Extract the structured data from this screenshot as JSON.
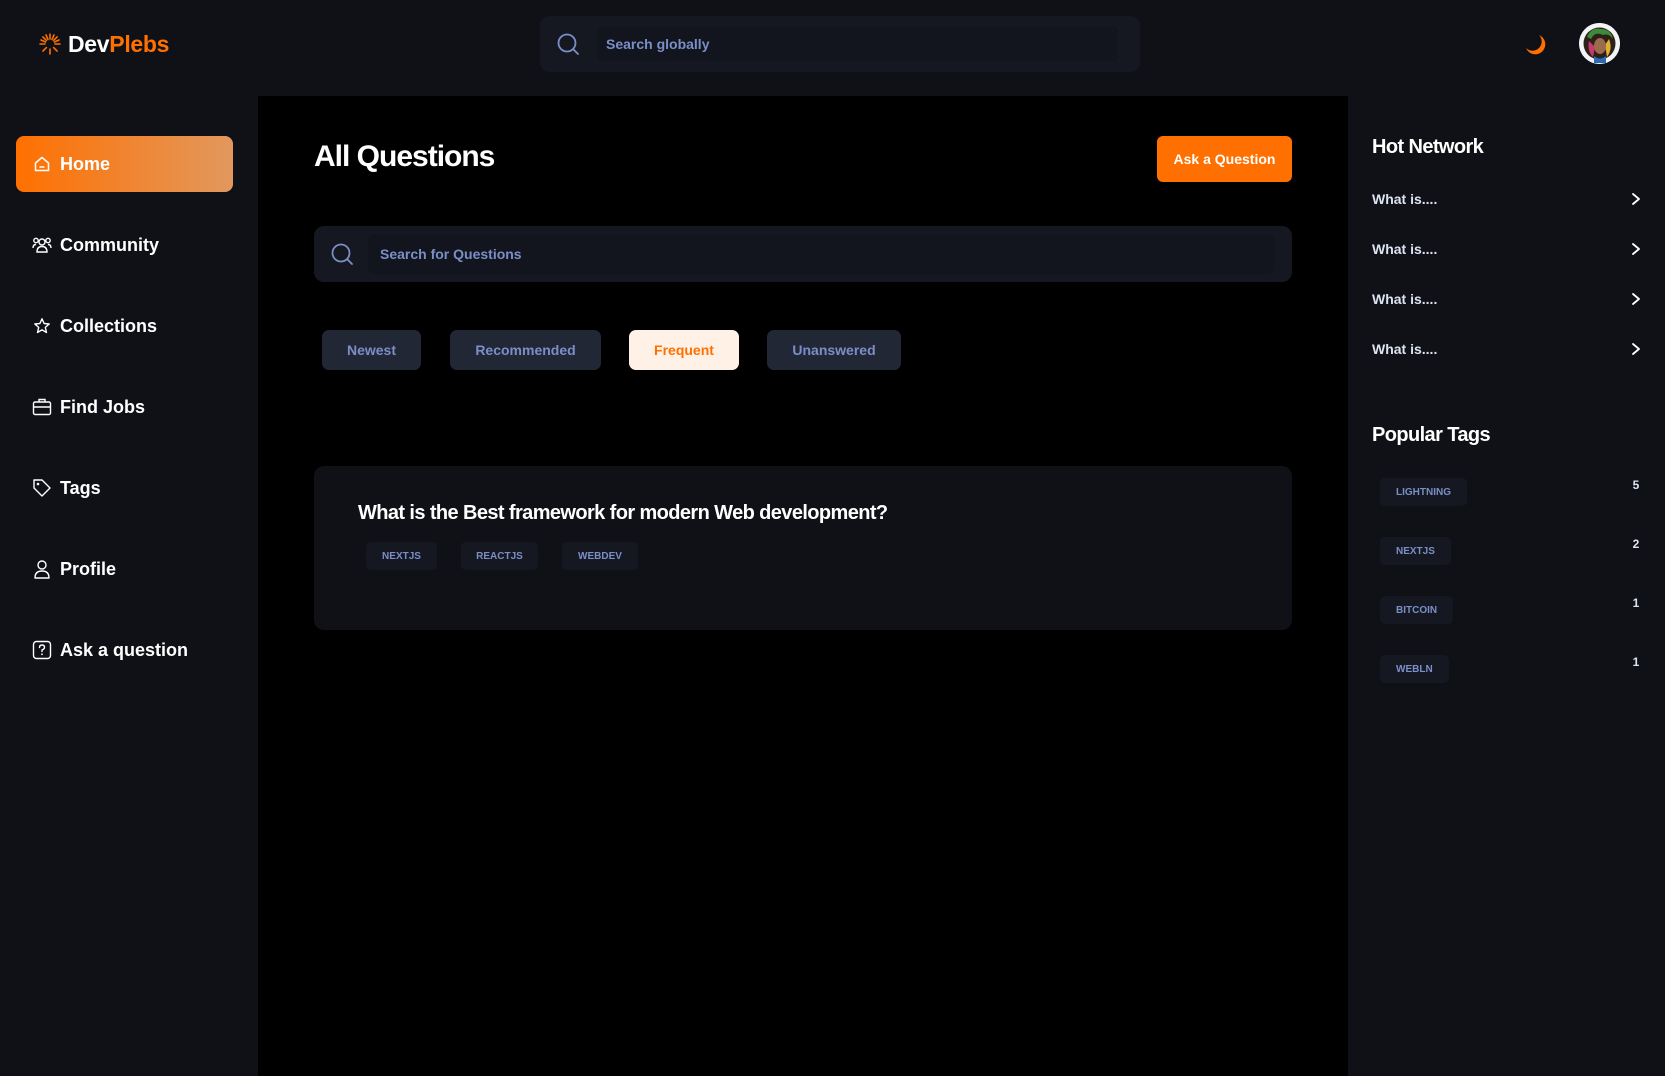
{
  "brand": {
    "part1": "Dev",
    "part2": "Plebs"
  },
  "header": {
    "search_placeholder": "Search globally"
  },
  "sidebar": {
    "items": [
      {
        "label": "Home",
        "icon": "home-icon",
        "active": true
      },
      {
        "label": "Community",
        "icon": "users-icon",
        "active": false
      },
      {
        "label": "Collections",
        "icon": "star-icon",
        "active": false
      },
      {
        "label": "Find Jobs",
        "icon": "suitcase-icon",
        "active": false
      },
      {
        "label": "Tags",
        "icon": "tag-icon",
        "active": false
      },
      {
        "label": "Profile",
        "icon": "user-icon",
        "active": false
      },
      {
        "label": "Ask a question",
        "icon": "question-icon",
        "active": false
      }
    ]
  },
  "main": {
    "title": "All Questions",
    "ask_button": "Ask a Question",
    "search_placeholder": "Search for Questions",
    "filters": [
      {
        "label": "Newest",
        "active": false
      },
      {
        "label": "Recommended",
        "active": false
      },
      {
        "label": "Frequent",
        "active": true
      },
      {
        "label": "Unanswered",
        "active": false
      }
    ],
    "questions": [
      {
        "title": "What is the Best framework for modern Web development?",
        "tags": [
          "NEXTJS",
          "REACTJS",
          "WEBDEV"
        ]
      }
    ]
  },
  "right": {
    "hot_network_title": "Hot Network",
    "hot_network": [
      "What is....",
      "What is....",
      "What is....",
      "What is...."
    ],
    "popular_tags_title": "Popular Tags",
    "popular_tags": [
      {
        "name": "LIGHTNING",
        "count": "5"
      },
      {
        "name": "NEXTJS",
        "count": "2"
      },
      {
        "name": "BITCOIN",
        "count": "1"
      },
      {
        "name": "WEBLN",
        "count": "1"
      }
    ]
  },
  "colors": {
    "accent": "#ff7000",
    "background": "#000000",
    "panel": "#0f1117",
    "muted_text": "#7b8ec8"
  }
}
